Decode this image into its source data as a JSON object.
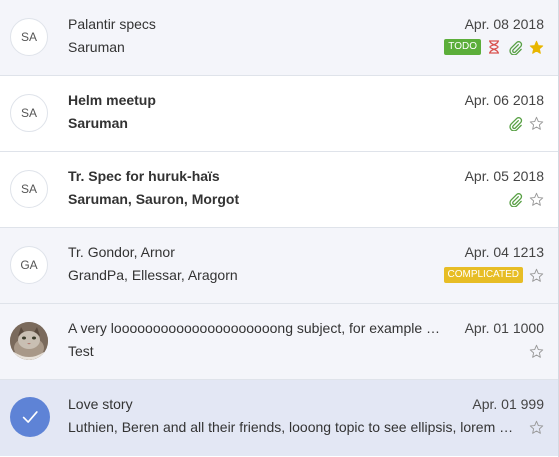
{
  "messages": [
    {
      "avatar_initials": "SA",
      "subject": "Palantir specs",
      "from": "Saruman",
      "date": "Apr. 08 2018",
      "badge": "TODO",
      "badge_color": "#5cae3a",
      "pending_icon": "hourglass-icon",
      "attachment": true,
      "starred": true,
      "unread": false
    },
    {
      "avatar_initials": "SA",
      "subject": "Helm meetup",
      "from": "Saruman",
      "date": "Apr. 06 2018",
      "attachment": true,
      "starred": false,
      "unread": true
    },
    {
      "avatar_initials": "SA",
      "subject": "Tr. Spec for huruk-haïs",
      "from": "Saruman, Sauron, Morgot",
      "date": "Apr. 05 2018",
      "attachment": true,
      "starred": false,
      "unread": true
    },
    {
      "avatar_initials": "GA",
      "subject": "Tr. Gondor, Arnor",
      "from": "GrandPa, Ellessar, Aragorn",
      "date": "Apr. 04 1213",
      "badge": "COMPLICATED",
      "badge_color": "#e7bd25",
      "attachment": false,
      "starred": false,
      "unread": false
    },
    {
      "avatar_image": "cat-photo",
      "subject": "A very looooooooooooooooooooong subject, for example Silmarillion",
      "from": "Test",
      "date": "Apr. 01 1000",
      "attachment": false,
      "starred": false,
      "unread": false
    },
    {
      "selected": true,
      "subject": "Love story",
      "from": "Luthien, Beren and all their friends, looong topic to see ellipsis, lorem dolor sit amet",
      "date": "Apr. 01 999",
      "attachment": false,
      "starred": false,
      "unread": false
    }
  ],
  "colors": {
    "row_background": "#f4f5fa",
    "row_background_unread": "#ffffff",
    "row_background_selected": "#e3e7f4",
    "attachment": "#58a045",
    "star_active": "#e8b600",
    "star_inactive": "#999999",
    "pending": "#d9534f",
    "check_avatar": "#5e83d6"
  }
}
